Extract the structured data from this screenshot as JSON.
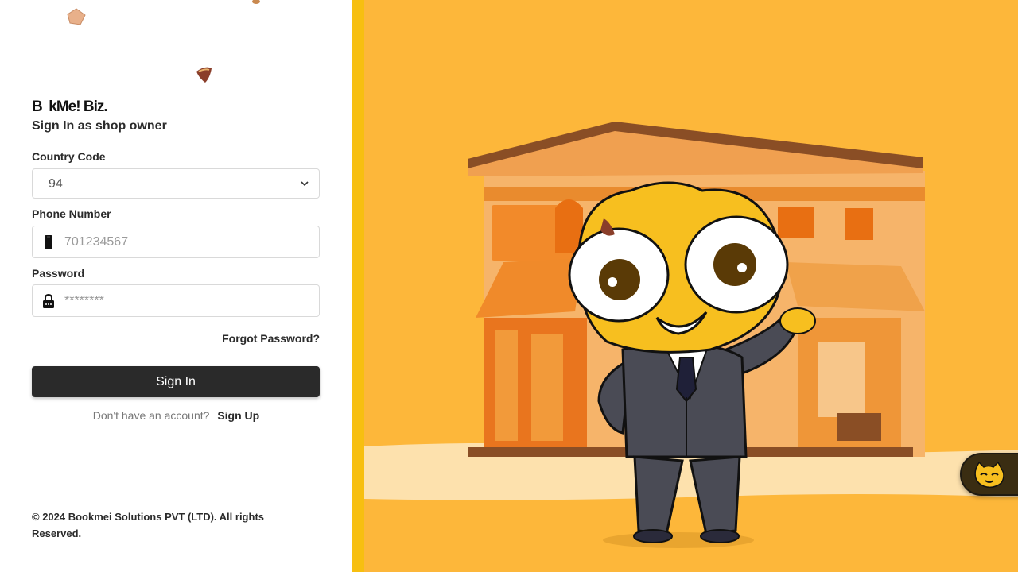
{
  "brand": {
    "logo_text": "B  kMe! Biz."
  },
  "form": {
    "subtitle": "Sign In as shop owner",
    "country_code_label": "Country Code",
    "country_code_value": "94",
    "phone_label": "Phone Number",
    "phone_placeholder": "701234567",
    "password_label": "Password",
    "password_placeholder": "********",
    "forgot_label": "Forgot Password?",
    "signin_label": "Sign In",
    "no_account_text": "Don't have an account?",
    "signup_label": "Sign Up"
  },
  "footer": {
    "copyright": "© 2024 Bookmei Solutions PVT (LTD). All rights Reserved."
  },
  "colors": {
    "accent_yellow": "#fdb73a",
    "stripe": "#f7bf10",
    "button_dark": "#2a2a2a"
  },
  "icons": {
    "phone": "mobile-phone-icon",
    "password": "padlock-icon",
    "chevron": "chevron-down-icon",
    "chat": "mascot-chat-icon"
  }
}
